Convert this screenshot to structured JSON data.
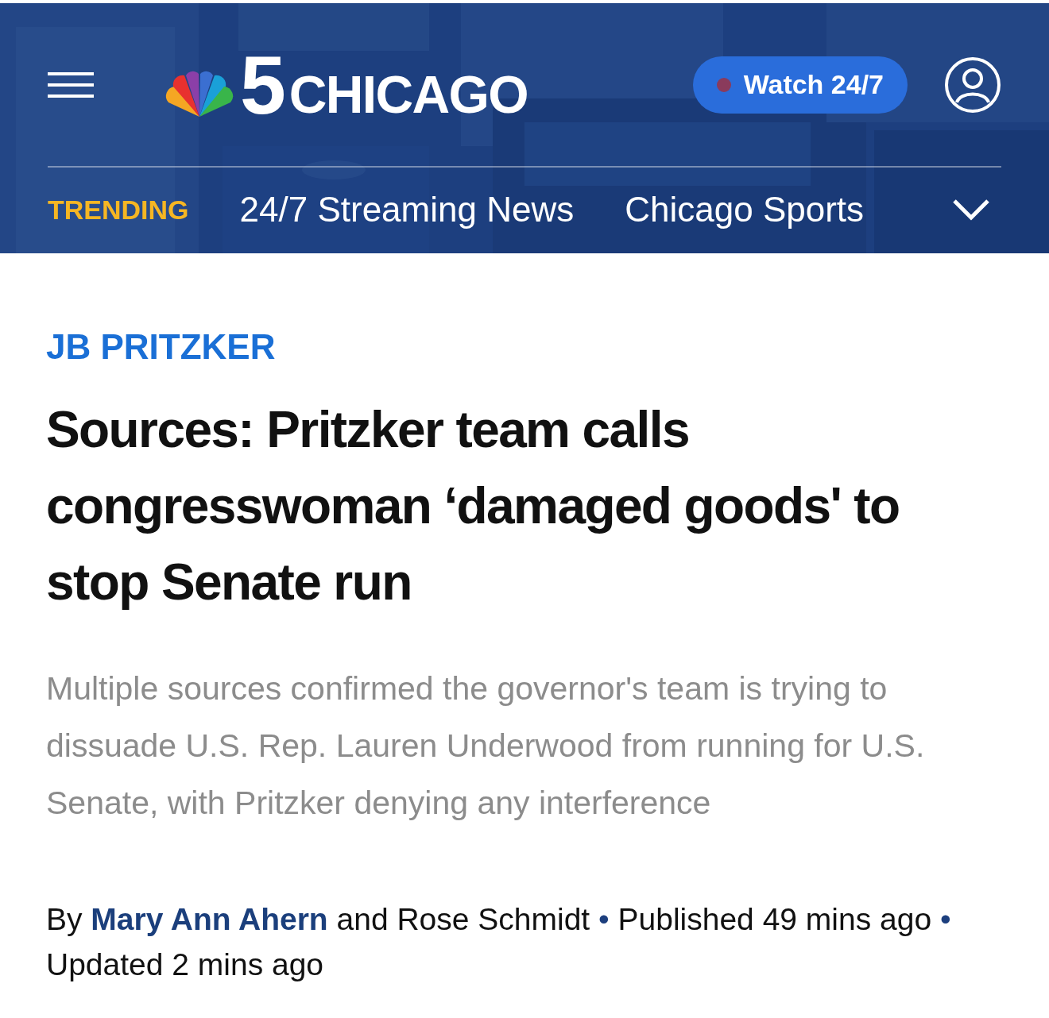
{
  "header": {
    "logo_number": "5",
    "logo_text": "CHICAGO",
    "watch_button": {
      "label": "Watch 24/7",
      "live": true
    }
  },
  "trending": {
    "label": "TRENDING",
    "links": [
      "24/7 Streaming News",
      "Chicago Sports"
    ]
  },
  "article": {
    "kicker": "JB PRITZKER",
    "headline": "Sources: Pritzker team calls congresswoman ‘damaged goods' to stop Senate run",
    "dek": "Multiple sources confirmed the governor's team is trying to dissuade U.S. Rep. Lauren Underwood from running for U.S. Senate, with Pritzker denying any interference",
    "byline": {
      "prefix": "By",
      "author": "Mary Ann Ahern",
      "coauthor": "and Rose Schmidt",
      "separator": "•",
      "published": "Published 49 mins",
      "published_end": "ago",
      "updated": "Updated 2 mins ago"
    }
  }
}
